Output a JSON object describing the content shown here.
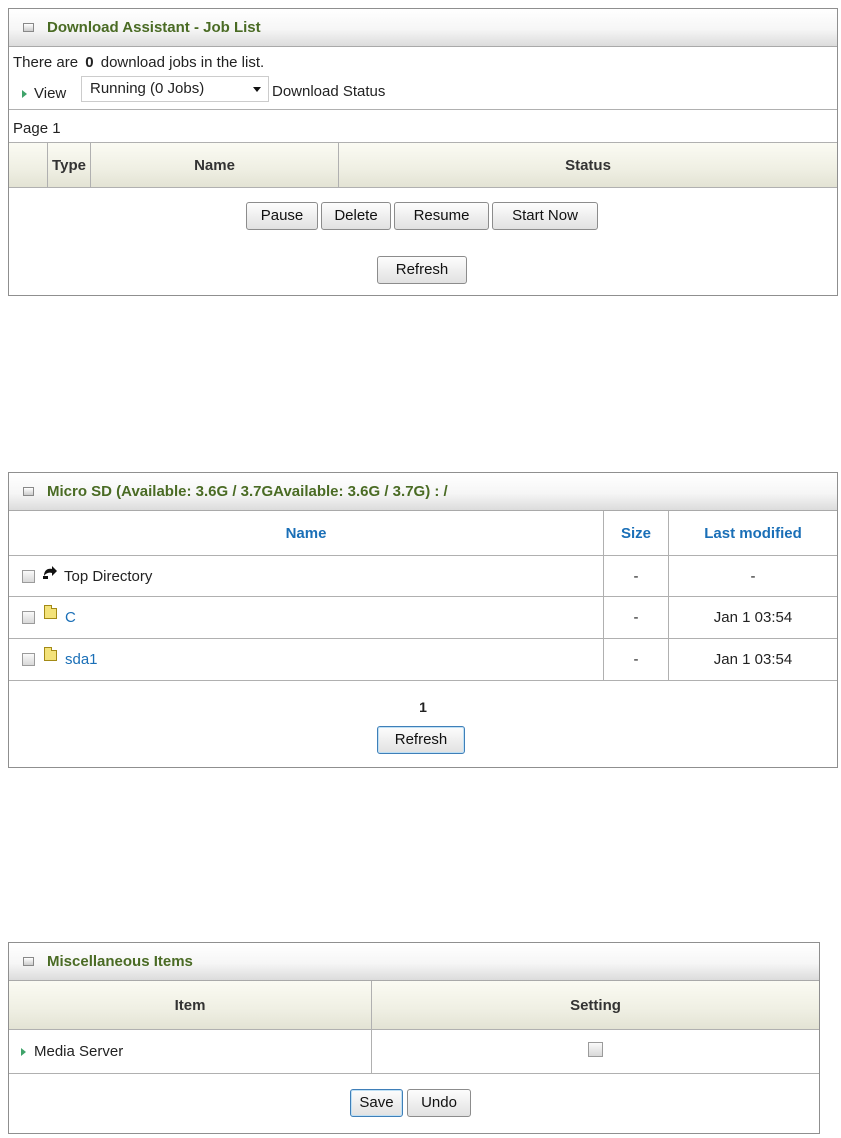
{
  "download_panel": {
    "title": "Download Assistant - Job List",
    "info_prefix": "There are",
    "job_count": "0",
    "info_suffix": "download jobs in the list.",
    "view_label": "View",
    "view_select_value": "Running (0 Jobs)",
    "status_label": "Download Status",
    "page_label": "Page 1",
    "columns": [
      "Type",
      "Name",
      "Status"
    ],
    "buttons": {
      "pause": "Pause",
      "delete": "Delete",
      "resume": "Resume",
      "start_now": "Start Now"
    },
    "refresh": "Refresh"
  },
  "microsd_panel": {
    "title": "Micro SD  (Available: 3.6G / 3.7GAvailable: 3.6G / 3.7G) :  /",
    "columns": [
      "Name",
      "Size",
      "Last modified"
    ],
    "rows": [
      {
        "name": "Top Directory",
        "icon": "top-directory-icon",
        "size": "-",
        "modified": "-"
      },
      {
        "name": "C",
        "icon": "folder-icon",
        "size": "-",
        "modified": "Jan 1 03:54"
      },
      {
        "name": "sda1",
        "icon": "folder-icon",
        "size": "-",
        "modified": "Jan 1 03:54"
      }
    ],
    "page_number": "1",
    "refresh": "Refresh"
  },
  "misc_panel": {
    "title": "Miscellaneous Items",
    "columns": [
      "Item",
      "Setting"
    ],
    "rows": [
      {
        "item": "Media Server",
        "checked": false
      }
    ],
    "save": "Save",
    "undo": "Undo"
  }
}
